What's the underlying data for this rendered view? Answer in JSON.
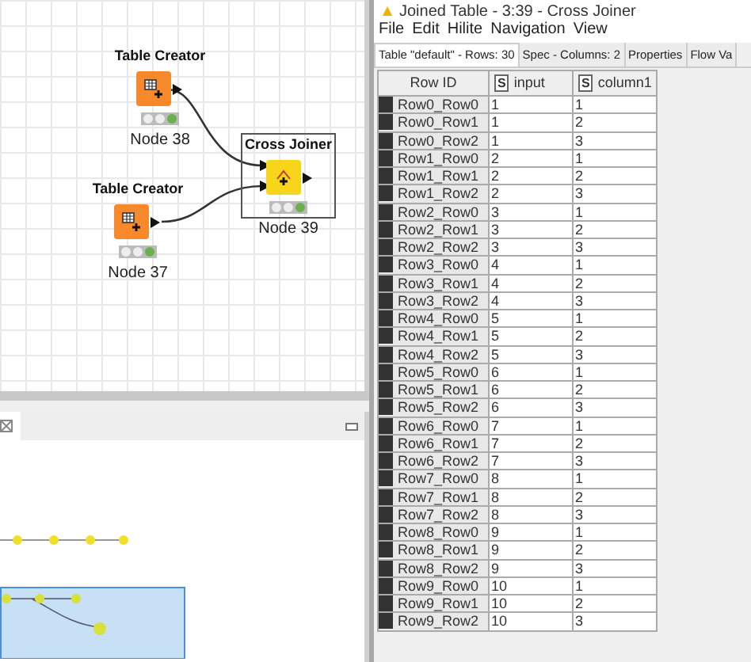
{
  "canvas": {
    "nodes": [
      {
        "title": "Table Creator",
        "label": "Node 38",
        "kind": "creator",
        "selected": false
      },
      {
        "title": "Table Creator",
        "label": "Node 37",
        "kind": "creator",
        "selected": false
      },
      {
        "title": "Cross Joiner",
        "label": "Node 39",
        "kind": "joiner",
        "selected": true
      }
    ]
  },
  "window": {
    "title": "Joined Table - 3:39 - Cross Joiner",
    "menu": [
      "File",
      "Edit",
      "Hilite",
      "Navigation",
      "View"
    ],
    "tabs": [
      {
        "label": "Table \"default\" - Rows: 30",
        "selected": true
      },
      {
        "label": "Spec - Columns: 2",
        "selected": false
      },
      {
        "label": "Properties",
        "selected": false
      },
      {
        "label": "Flow Va",
        "selected": false
      }
    ],
    "table": {
      "columns": [
        {
          "label": "Row ID"
        },
        {
          "label": "input",
          "type": "S"
        },
        {
          "label": "column1",
          "type": "S"
        }
      ],
      "rows": [
        [
          "Row0_Row0",
          "1",
          "1"
        ],
        [
          "Row0_Row1",
          "1",
          "2"
        ],
        [
          "Row0_Row2",
          "1",
          "3"
        ],
        [
          "Row1_Row0",
          "2",
          "1"
        ],
        [
          "Row1_Row1",
          "2",
          "2"
        ],
        [
          "Row1_Row2",
          "2",
          "3"
        ],
        [
          "Row2_Row0",
          "3",
          "1"
        ],
        [
          "Row2_Row1",
          "3",
          "2"
        ],
        [
          "Row2_Row2",
          "3",
          "3"
        ],
        [
          "Row3_Row0",
          "4",
          "1"
        ],
        [
          "Row3_Row1",
          "4",
          "2"
        ],
        [
          "Row3_Row2",
          "4",
          "3"
        ],
        [
          "Row4_Row0",
          "5",
          "1"
        ],
        [
          "Row4_Row1",
          "5",
          "2"
        ],
        [
          "Row4_Row2",
          "5",
          "3"
        ],
        [
          "Row5_Row0",
          "6",
          "1"
        ],
        [
          "Row5_Row1",
          "6",
          "2"
        ],
        [
          "Row5_Row2",
          "6",
          "3"
        ],
        [
          "Row6_Row0",
          "7",
          "1"
        ],
        [
          "Row6_Row1",
          "7",
          "2"
        ],
        [
          "Row6_Row2",
          "7",
          "3"
        ],
        [
          "Row7_Row0",
          "8",
          "1"
        ],
        [
          "Row7_Row1",
          "8",
          "2"
        ],
        [
          "Row7_Row2",
          "8",
          "3"
        ],
        [
          "Row8_Row0",
          "9",
          "1"
        ],
        [
          "Row8_Row1",
          "9",
          "2"
        ],
        [
          "Row8_Row2",
          "9",
          "3"
        ],
        [
          "Row9_Row0",
          "10",
          "1"
        ],
        [
          "Row9_Row1",
          "10",
          "2"
        ],
        [
          "Row9_Row2",
          "10",
          "3"
        ]
      ]
    }
  }
}
